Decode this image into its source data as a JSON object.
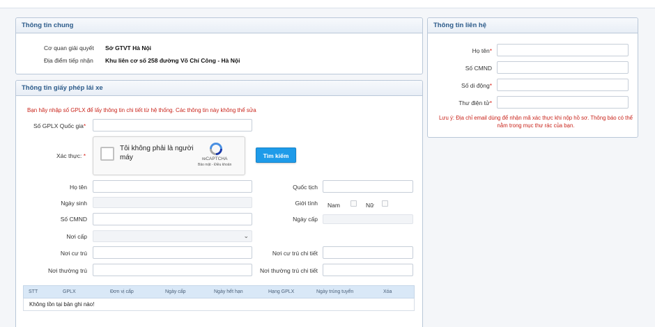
{
  "general": {
    "title": "Thông tin chung",
    "agency_label": "Cơ quan giải quyết",
    "agency_value": "Sở GTVT Hà Nội",
    "location_label": "Địa điểm tiếp nhận",
    "location_value": "Khu liên cơ số 258 đường Võ Chí Công - Hà Nội"
  },
  "license": {
    "title": "Thông tin giấy phép lái xe",
    "notice": "Bạn hãy nhập số GPLX để lấy thông tin chi tiết từ hệ thống. Các thông tin này không thể sửa",
    "gplx_label": "Số GPLX Quốc gia",
    "verify_label": "Xác thực: ",
    "required_mark": "*",
    "captcha_text": "Tôi không phải là người máy",
    "captcha_brand": "reCAPTCHA",
    "captcha_links": "Bảo mật - Điều khoản",
    "search_button": "Tìm kiếm",
    "fullname_label": "Họ tên",
    "nationality_label": "Quốc tịch",
    "dob_label": "Ngày sinh",
    "gender_label": "Giới tính",
    "male_label": "Nam",
    "female_label": "Nữ",
    "id_label": "Số CMND",
    "issue_date_label": "Ngày cấp",
    "issue_place_label": "Nơi cấp",
    "residence_label": "Nơi cư trú",
    "residence_detail_label": "Nơi cư trú chi tiết",
    "permanent_label": "Nơi thường trú",
    "permanent_detail_label": "Nơi thường trú chi tiết",
    "table": {
      "columns": [
        "STT",
        "GPLX",
        "Đơn vị cấp",
        "Ngày cấp",
        "Ngày hết hạn",
        "Hạng GPLX",
        "Ngày trúng tuyển",
        "Xóa"
      ],
      "empty_message": "Không tồn tại bản ghi nào!"
    }
  },
  "contact": {
    "title": "Thông tin liên hệ",
    "name_label": "Họ tên",
    "id_label": "Số CMND",
    "phone_label": "Số di động",
    "email_label": "Thư điện tử",
    "required_mark": "*",
    "note": "Lưu ý: Địa chỉ email dùng để nhận mã xác thực khi nộp hồ sơ. Thông báo có thể nằm trong mục thư rác của bạn."
  },
  "icons": {
    "captcha": "recaptcha-logo-icon",
    "select": "chevron-down-icon"
  },
  "colors": {
    "header_text": "#2c5b8a",
    "button": "#1e9be9",
    "required": "#d9261c",
    "table_header": "#d9e8f7"
  }
}
